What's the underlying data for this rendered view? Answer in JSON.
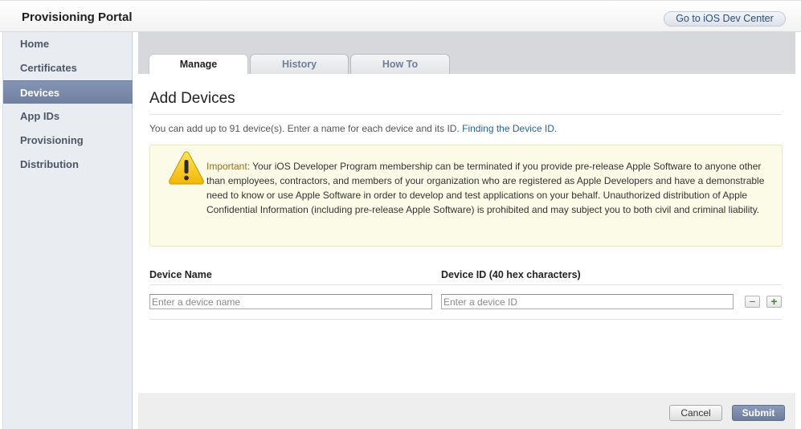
{
  "header": {
    "title": "Provisioning Portal",
    "dev_center_label": "Go to iOS Dev Center"
  },
  "sidebar": {
    "items": [
      {
        "label": "Home"
      },
      {
        "label": "Certificates"
      },
      {
        "label": "Devices",
        "active": true
      },
      {
        "label": "App IDs"
      },
      {
        "label": "Provisioning"
      },
      {
        "label": "Distribution"
      }
    ]
  },
  "tabs": [
    {
      "label": "Manage",
      "active": true
    },
    {
      "label": "History"
    },
    {
      "label": "How To"
    }
  ],
  "main": {
    "title": "Add Devices",
    "intro_text": "You can add up to 91 device(s). Enter a name for each device and its ID.",
    "intro_link": "Finding the Device ID."
  },
  "warning": {
    "icon": "warning-triangle-icon",
    "label": "Important:",
    "text": "Your iOS Developer Program membership can be terminated if you provide pre-release Apple Software to anyone other than employees, contractors, and members of your organization who are registered as Apple Developers and have a demonstrable need to know or use Apple Software in order to develop and test applications on your behalf. Unauthorized distribution of Apple Confidential Information (including pre-release Apple Software) is prohibited and may subject you to both civil and criminal liability."
  },
  "form": {
    "name_header": "Device Name",
    "id_header": "Device ID (40 hex characters)",
    "name_placeholder": "Enter a device name",
    "id_placeholder": "Enter a device ID",
    "name_value": "",
    "id_value": "",
    "remove_label": "−",
    "add_label": "+"
  },
  "footer": {
    "cancel_label": "Cancel",
    "submit_label": "Submit"
  },
  "colors": {
    "accent": "#7887a6",
    "link": "#2a6496",
    "warning_bg": "#fbfbe8"
  }
}
